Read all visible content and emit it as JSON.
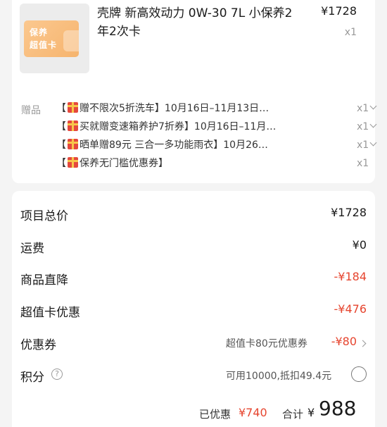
{
  "product": {
    "thumb_line1": "保养",
    "thumb_line2": "超值卡",
    "title": "壳牌 新高效动力 0W-30 7L 小保养2年2次卡",
    "price": "¥1728",
    "qty": "x1"
  },
  "gifts": {
    "label": "赠品",
    "items": [
      {
        "text_open": "【",
        "text": "赠不限次5折洗车】10月16日–11月13日…",
        "qty": "x1",
        "has_chevron": true
      },
      {
        "text_open": "【",
        "text": "买就赠变速箱养护7折券】10月16日–11月…",
        "qty": "x1",
        "has_chevron": true
      },
      {
        "text_open": "【",
        "text": "晒单赠89元 三合一多功能雨衣】10月26…",
        "qty": "x1",
        "has_chevron": true
      },
      {
        "text_open": "【",
        "text": "保养无门槛优惠券】",
        "qty": "x1",
        "has_chevron": false
      }
    ]
  },
  "summary": {
    "total_label": "项目总价",
    "total_value": "¥1728",
    "shipping_label": "运费",
    "shipping_value": "¥0",
    "direct_discount_label": "商品直降",
    "direct_discount_value": "-¥184",
    "card_discount_label": "超值卡优惠",
    "card_discount_value": "-¥476",
    "coupon_label": "优惠券",
    "coupon_desc": "超值卡80元优惠券",
    "coupon_value": "-¥80",
    "points_label": "积分",
    "points_help": "?",
    "points_desc": "可用10000,抵扣49.4元"
  },
  "totals": {
    "saved_label": "已优惠",
    "saved_value": "¥740",
    "sum_label": "合计",
    "sum_currency": "¥",
    "sum_value": "988"
  },
  "colors": {
    "accent_red": "#e6452f",
    "muted": "#999999",
    "thumb_orange": "#f6b46e"
  }
}
